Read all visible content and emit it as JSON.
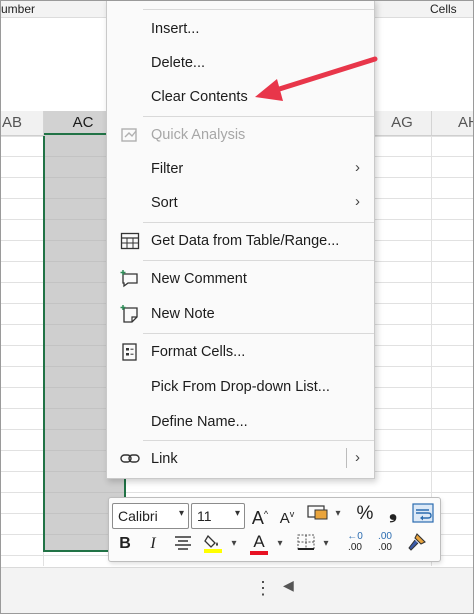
{
  "ribbon": {
    "group_number_partial": "umber",
    "group_cells": "Cells"
  },
  "columns": [
    {
      "label": "AB",
      "selected": false
    },
    {
      "label": "AC",
      "selected": true
    },
    {
      "label": "AG",
      "selected": false
    },
    {
      "label": "AH",
      "selected": false
    }
  ],
  "context_menu": {
    "items": [
      {
        "label": "Insert...",
        "icon": "",
        "disabled": false,
        "submenu": false
      },
      {
        "label": "Delete...",
        "icon": "",
        "disabled": false,
        "submenu": false
      },
      {
        "label": "Clear Contents",
        "icon": "",
        "disabled": false,
        "submenu": false
      },
      {
        "label": "Quick Analysis",
        "icon": "quick-analysis-icon",
        "disabled": true,
        "submenu": false
      },
      {
        "label": "Filter",
        "icon": "",
        "disabled": false,
        "submenu": true
      },
      {
        "label": "Sort",
        "icon": "",
        "disabled": false,
        "submenu": true
      },
      {
        "label": "Get Data from Table/Range...",
        "icon": "table-icon",
        "disabled": false,
        "submenu": false
      },
      {
        "label": "New Comment",
        "icon": "new-comment-icon",
        "disabled": false,
        "submenu": false
      },
      {
        "label": "New Note",
        "icon": "new-note-icon",
        "disabled": false,
        "submenu": false
      },
      {
        "label": "Format Cells...",
        "icon": "format-cells-icon",
        "disabled": false,
        "submenu": false
      },
      {
        "label": "Pick From Drop-down List...",
        "icon": "",
        "disabled": false,
        "submenu": false
      },
      {
        "label": "Define Name...",
        "icon": "",
        "disabled": false,
        "submenu": false
      },
      {
        "label": "Link",
        "icon": "link-icon",
        "disabled": false,
        "submenu": true
      }
    ]
  },
  "mini_toolbar": {
    "font_name": "Calibri",
    "font_size": "11",
    "grow_font_label": "A",
    "shrink_font_label": "A",
    "percent_label": "%",
    "comma_label": "❟",
    "bold_label": "B",
    "italic_label": "I",
    "font_color_label": "A",
    "increase_decimal_label": ".00",
    "decrease_decimal_label": ".00",
    "fill_color": "#ffff00",
    "font_color": "#e81123"
  },
  "status_bar": {
    "more_label": "⋮",
    "scroll_left_label": "◀"
  },
  "colors": {
    "selection_green": "#217346",
    "annotation_red": "#e8364a"
  }
}
